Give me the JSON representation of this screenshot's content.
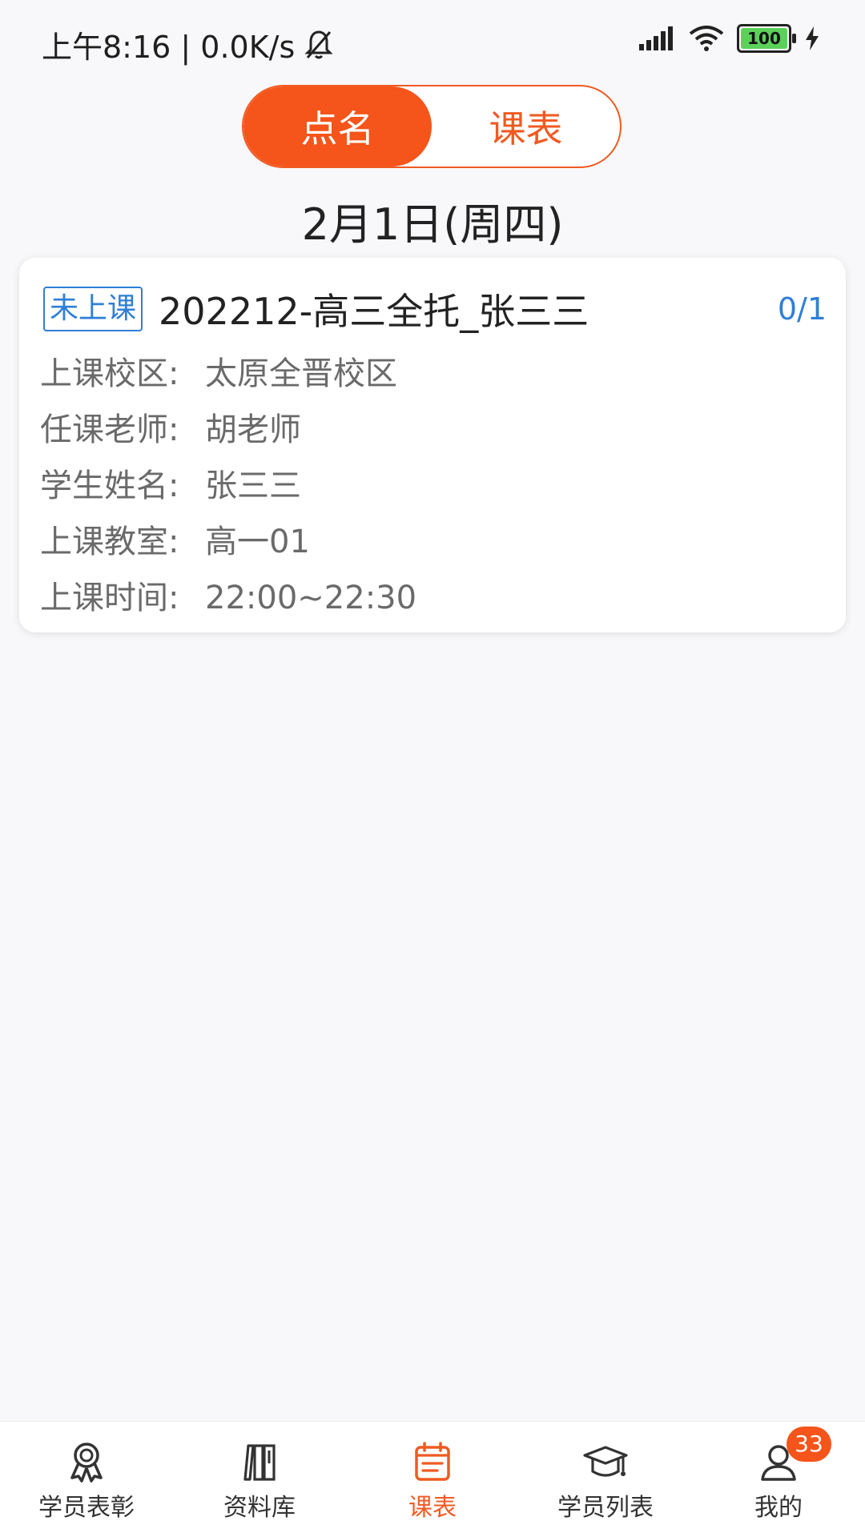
{
  "status_bar": {
    "time_info": "上午8:16 | 0.0K/s",
    "battery": "100",
    "icons": [
      "bell-off-icon",
      "signal-icon",
      "wifi-icon",
      "battery-icon",
      "charging-icon"
    ]
  },
  "segments": {
    "tab1": "点名",
    "tab2": "课表",
    "active": "点名"
  },
  "date": "2月1日(周四)",
  "card": {
    "status": "未上课",
    "title": "202212-高三全托_张三三",
    "count": "0/1",
    "rows": [
      {
        "label": "上课校区:",
        "value": "太原全晋校区"
      },
      {
        "label": "任课老师:",
        "value": "胡老师"
      },
      {
        "label": "学生姓名:",
        "value": "张三三"
      },
      {
        "label": "上课教室:",
        "value": "高一01"
      },
      {
        "label": "上课时间:",
        "value": "22:00~22:30"
      }
    ]
  },
  "nav": {
    "items": [
      {
        "label": "学员表彰",
        "icon": "award-icon"
      },
      {
        "label": "资料库",
        "icon": "library-icon"
      },
      {
        "label": "课表",
        "icon": "schedule-icon",
        "active": true
      },
      {
        "label": "学员列表",
        "icon": "graduation-cap-icon"
      },
      {
        "label": "我的",
        "icon": "user-icon",
        "badge": "33"
      }
    ]
  },
  "colors": {
    "accent": "#f5541a",
    "link_blue": "#2f7fd6"
  }
}
